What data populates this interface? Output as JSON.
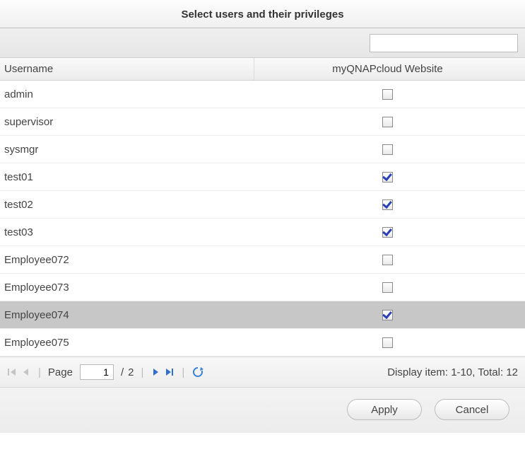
{
  "title": "Select users and their privileges",
  "search": {
    "value": "",
    "placeholder": ""
  },
  "columns": {
    "username": "Username",
    "privilege": "myQNAPcloud Website"
  },
  "rows": [
    {
      "username": "admin",
      "checked": false,
      "selected": false
    },
    {
      "username": "supervisor",
      "checked": false,
      "selected": false
    },
    {
      "username": "sysmgr",
      "checked": false,
      "selected": false
    },
    {
      "username": "test01",
      "checked": true,
      "selected": false
    },
    {
      "username": "test02",
      "checked": true,
      "selected": false
    },
    {
      "username": "test03",
      "checked": true,
      "selected": false
    },
    {
      "username": "Employee072",
      "checked": false,
      "selected": false
    },
    {
      "username": "Employee073",
      "checked": false,
      "selected": false
    },
    {
      "username": "Employee074",
      "checked": true,
      "selected": true
    },
    {
      "username": "Employee075",
      "checked": false,
      "selected": false
    }
  ],
  "pager": {
    "page_label": "Page",
    "current": "1",
    "total_pages": "2",
    "separator": "/",
    "display": "Display item: 1-10, Total: 12"
  },
  "buttons": {
    "apply": "Apply",
    "cancel": "Cancel"
  }
}
